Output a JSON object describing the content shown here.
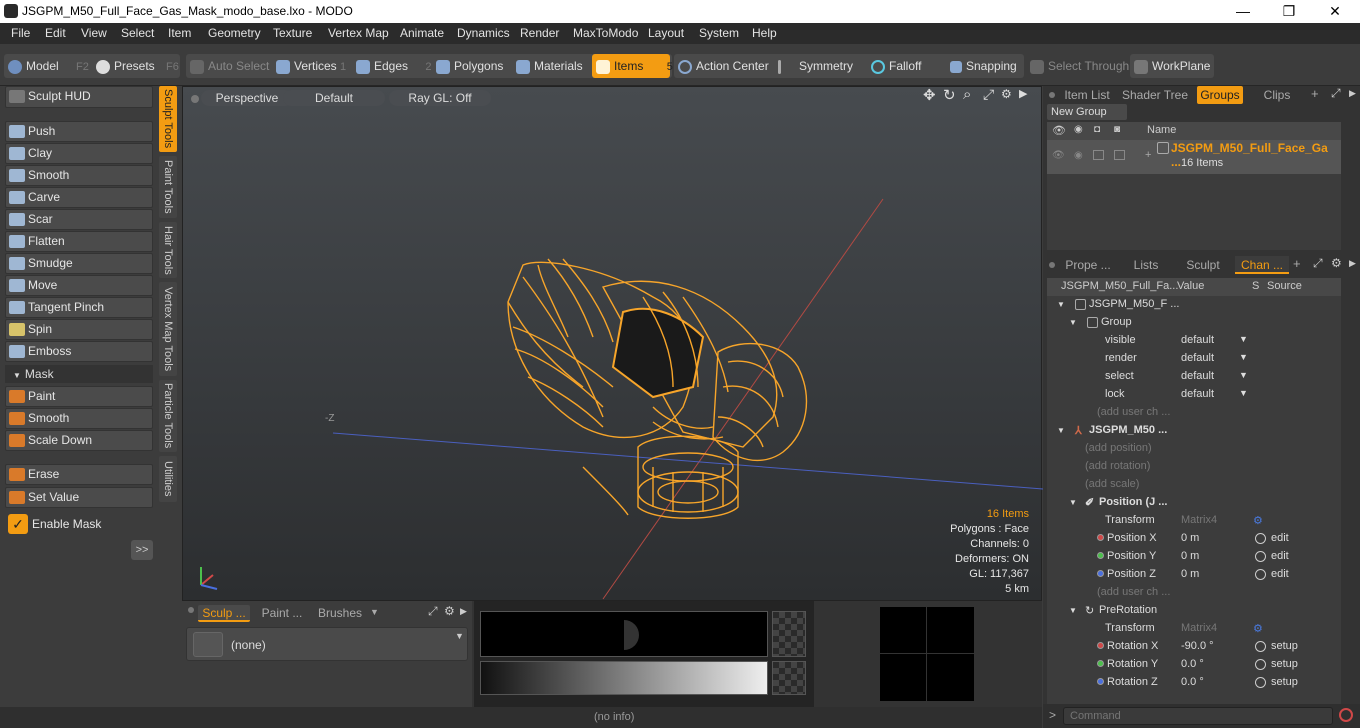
{
  "window": {
    "title": "JSGPM_M50_Full_Face_Gas_Mask_modo_base.lxo - MODO",
    "minimize": "—",
    "maximize": "❐",
    "close": "✕"
  },
  "menu": [
    "File",
    "Edit",
    "View",
    "Select",
    "Item",
    "Geometry",
    "Texture",
    "Vertex Map",
    "Animate",
    "Dynamics",
    "Render",
    "MaxToModo",
    "Layout",
    "System",
    "Help"
  ],
  "toolbar": {
    "model": "Model",
    "model_key": "F2",
    "presets": "Presets",
    "presets_key": "F6",
    "auto_select": "Auto Select",
    "vertices": "Vertices",
    "vertices_key": "1",
    "edges": "Edges",
    "edges_key": "2",
    "polygons": "Polygons",
    "materials": "Materials",
    "items": "Items",
    "items_key": "5",
    "action_center": "Action Center",
    "symmetry": "Symmetry",
    "falloff": "Falloff",
    "snapping": "Snapping",
    "select_through": "Select Through",
    "workplane": "WorkPlane"
  },
  "left": {
    "sculpt_hud": "Sculpt HUD",
    "tools": [
      "Push",
      "Clay",
      "Smooth",
      "Carve",
      "Scar",
      "Flatten",
      "Smudge",
      "Move",
      "Tangent Pinch",
      "Spin",
      "Emboss"
    ],
    "mask_header": "Mask",
    "mask_tools": [
      "Paint",
      "Smooth",
      "Scale Down"
    ],
    "erase": "Erase",
    "set_value": "Set Value",
    "enable_mask": "Enable Mask",
    "expand": ">>",
    "vtabs": [
      "Sculpt Tools",
      "Paint Tools",
      "Hair Tools",
      "Vertex Map Tools",
      "Particle Tools",
      "Utilities"
    ]
  },
  "viewport": {
    "perspective": "Perspective",
    "default": "Default",
    "raygl": "Ray GL: Off",
    "axis_label": "-Z",
    "stats": [
      "16 Items",
      "Polygons : Face",
      "Channels: 0",
      "Deformers: ON",
      "GL: 117,367",
      "5 km"
    ]
  },
  "bottom": {
    "tabs": [
      "Sculp ...",
      "Paint ...",
      "Brushes"
    ],
    "brush_none": "(none)"
  },
  "status": {
    "info": "(no info)",
    "command_placeholder": "Command"
  },
  "right": {
    "tabs_top": [
      "Item List",
      "Shader Tree",
      "Groups",
      "Clips"
    ],
    "new_group": "New Group",
    "col_name": "Name",
    "group_name": "JSGPM_M50_Full_Face_Ga ...",
    "group_count": "16 Items",
    "tabs_mid": [
      "Prope ...",
      "Lists",
      "Sculpt",
      "Chan ..."
    ],
    "chan_header": {
      "name": "JSGPM_M50_Full_Fa...",
      "value": "Value",
      "s": "S",
      "source": "Source"
    },
    "channels": [
      {
        "indent": 20,
        "name": "JSGPM_M50_F ...",
        "value": "",
        "source": ""
      },
      {
        "indent": 34,
        "name": "Group",
        "value": "",
        "source": ""
      },
      {
        "indent": 54,
        "name": "visible",
        "value": "default",
        "source": ""
      },
      {
        "indent": 54,
        "name": "render",
        "value": "default",
        "source": ""
      },
      {
        "indent": 54,
        "name": "select",
        "value": "default",
        "source": ""
      },
      {
        "indent": 54,
        "name": "lock",
        "value": "default",
        "source": ""
      },
      {
        "indent": 46,
        "name": "(add user ch ...",
        "value": "",
        "source": ""
      },
      {
        "indent": 20,
        "name": "JSGPM_M50 ...",
        "value": "",
        "source": ""
      },
      {
        "indent": 34,
        "name": "(add position)",
        "value": "",
        "source": ""
      },
      {
        "indent": 34,
        "name": "(add rotation)",
        "value": "",
        "source": ""
      },
      {
        "indent": 34,
        "name": "(add scale)",
        "value": "",
        "source": ""
      },
      {
        "indent": 34,
        "name": "Position (J ...",
        "value": "",
        "source": ""
      },
      {
        "indent": 54,
        "name": "Transform",
        "value": "Matrix4",
        "source": ""
      },
      {
        "indent": 46,
        "name": "Position X",
        "value": "0 m",
        "source": "edit"
      },
      {
        "indent": 46,
        "name": "Position Y",
        "value": "0 m",
        "source": "edit"
      },
      {
        "indent": 46,
        "name": "Position Z",
        "value": "0 m",
        "source": "edit"
      },
      {
        "indent": 46,
        "name": "(add user ch ...",
        "value": "",
        "source": ""
      },
      {
        "indent": 34,
        "name": "PreRotation",
        "value": "",
        "source": ""
      },
      {
        "indent": 54,
        "name": "Transform",
        "value": "Matrix4",
        "source": ""
      },
      {
        "indent": 46,
        "name": "Rotation X",
        "value": "-90.0 °",
        "source": "setup"
      },
      {
        "indent": 46,
        "name": "Rotation Y",
        "value": "0.0 °",
        "source": "setup"
      },
      {
        "indent": 46,
        "name": "Rotation Z",
        "value": "0.0 °",
        "source": "setup"
      }
    ]
  },
  "colors": {
    "accent": "#f39c12",
    "wire": "#f7a52a",
    "selected_tab": "#f39c12"
  }
}
